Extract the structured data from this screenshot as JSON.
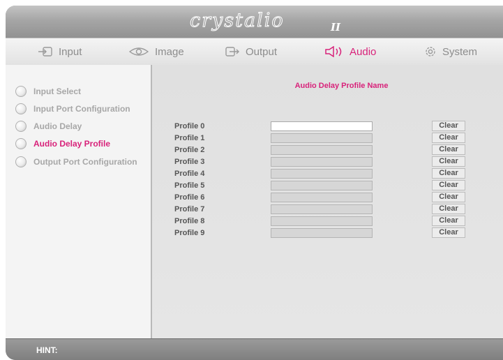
{
  "app": {
    "logo_text": "crystalio",
    "logo_suffix": "II"
  },
  "nav": {
    "tabs": [
      {
        "label": "Input",
        "icon": "input-icon"
      },
      {
        "label": "Image",
        "icon": "eye-icon"
      },
      {
        "label": "Output",
        "icon": "output-icon"
      },
      {
        "label": "Audio",
        "icon": "speaker-icon",
        "active": true
      },
      {
        "label": "System",
        "icon": "gear-icon"
      }
    ]
  },
  "sidebar": {
    "items": [
      {
        "label": "Input Select"
      },
      {
        "label": "Input Port Configuration"
      },
      {
        "label": "Audio Delay"
      },
      {
        "label": "Audio Delay Profile",
        "active": true
      },
      {
        "label": "Output Port Configuration"
      }
    ]
  },
  "main": {
    "title": "Audio Delay Profile Name",
    "clear_label": "Clear",
    "profiles": [
      {
        "label": "Profile 0",
        "value": ""
      },
      {
        "label": "Profile 1",
        "value": ""
      },
      {
        "label": "Profile 2",
        "value": ""
      },
      {
        "label": "Profile 3",
        "value": ""
      },
      {
        "label": "Profile 4",
        "value": ""
      },
      {
        "label": "Profile 5",
        "value": ""
      },
      {
        "label": "Profile 6",
        "value": ""
      },
      {
        "label": "Profile 7",
        "value": ""
      },
      {
        "label": "Profile 8",
        "value": ""
      },
      {
        "label": "Profile 9",
        "value": ""
      }
    ]
  },
  "hint": {
    "label": "HINT:"
  },
  "colors": {
    "accent": "#d8227a",
    "inactive_text": "#a7a7a7",
    "label_text": "#555555"
  }
}
